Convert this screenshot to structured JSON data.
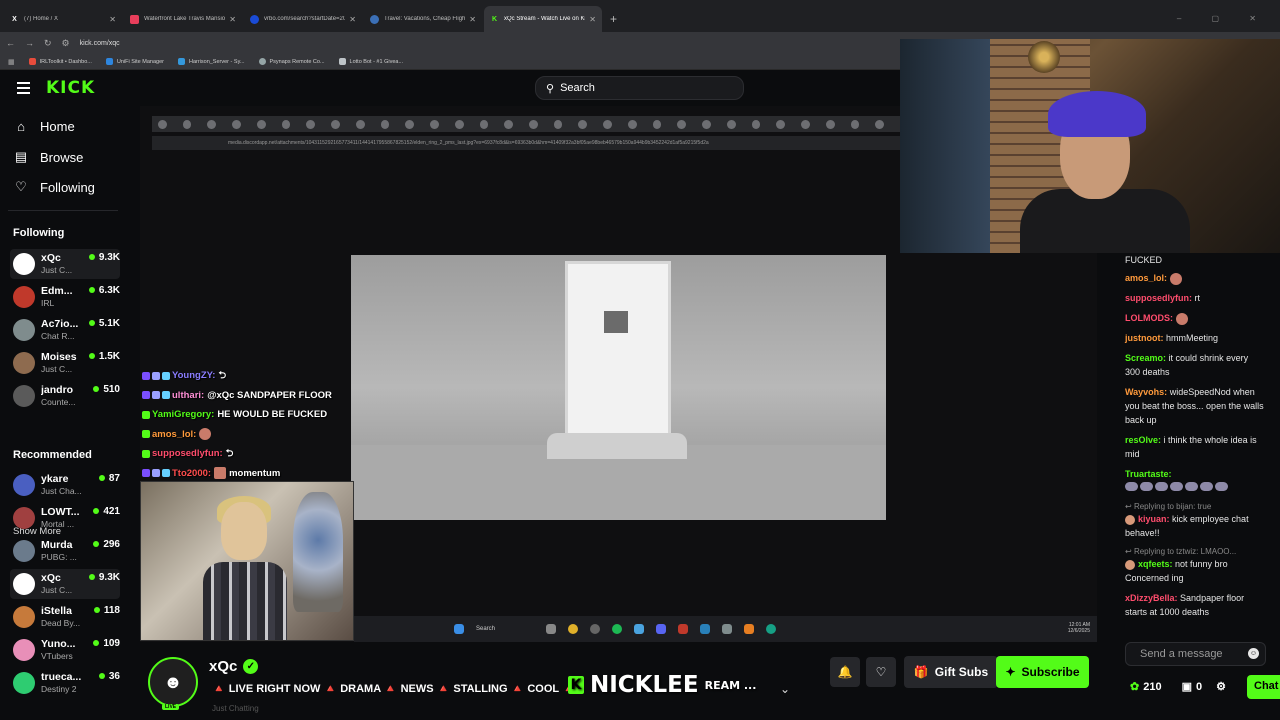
{
  "browser": {
    "tabs": [
      {
        "title": "(7) Home / X",
        "color": "#000000",
        "glyph": "X"
      },
      {
        "title": "Waterfront Lake Travis Mansion",
        "color": "#e83e5b",
        "glyph": ""
      },
      {
        "title": "vrbo.com/search?startDate=20",
        "color": "#1a4bd6",
        "glyph": ""
      },
      {
        "title": "Travel: Vacations, Cheap Flights",
        "color": "#3b6fb6",
        "glyph": ""
      },
      {
        "title": "xQc Stream - Watch Live on Kick",
        "color": "#53fc18",
        "glyph": "K"
      }
    ],
    "url": "kick.com/xqc",
    "bookmarks": [
      "IRLToolkit • Dashbo...",
      "UniFi Site Manager",
      "Harrison_Server - Sy...",
      "Psynaps Remote Co...",
      "Lotto Bot - #1 Givea..."
    ]
  },
  "header": {
    "logo": "KICK",
    "search_placeholder": "Search"
  },
  "nav": {
    "home": "Home",
    "browse": "Browse",
    "following": "Following"
  },
  "sidebar": {
    "following_heading": "Following",
    "following": [
      {
        "name": "xQc",
        "category": "Just C...",
        "viewers": "9.3K",
        "avatar": "#ffffff"
      },
      {
        "name": "Edm...",
        "category": "IRL",
        "viewers": "6.3K",
        "avatar": "#c0392b"
      },
      {
        "name": "Ac7io...",
        "category": "Chat R...",
        "viewers": "5.1K",
        "avatar": "#7f8c8d"
      },
      {
        "name": "Moises",
        "category": "Just C...",
        "viewers": "1.5K",
        "avatar": "#8e6b4f"
      },
      {
        "name": "jandro",
        "category": "Counte...",
        "viewers": "510",
        "avatar": "#5a5a5a"
      }
    ],
    "show_more": "Show More",
    "recommended_heading": "Recommended",
    "recommended": [
      {
        "name": "ykare",
        "category": "Just Cha...",
        "viewers": "87",
        "avatar": "#4a5fc1"
      },
      {
        "name": "LOWT...",
        "category": "Mortal ...",
        "viewers": "421",
        "avatar": "#a04040"
      },
      {
        "name": "Murda",
        "category": "PUBG: ...",
        "viewers": "296",
        "avatar": "#6b7b8c"
      },
      {
        "name": "xQc",
        "category": "Just C...",
        "viewers": "9.3K",
        "avatar": "#ffffff"
      },
      {
        "name": "iStella",
        "category": "Dead By...",
        "viewers": "118",
        "avatar": "#c67a3b"
      },
      {
        "name": "Yuno...",
        "category": "VTubers",
        "viewers": "109",
        "avatar": "#e88fb8"
      },
      {
        "name": "trueca...",
        "category": "Destiny 2",
        "viewers": "36",
        "avatar": "#2ecc71"
      }
    ]
  },
  "video": {
    "inner_url": "media.discordapp.net/attachments/1043115292165773411/1441417955867825152/elden_ring_2_pms_last.jpg?ex=6937fc8d&is=69363b0d&hm=41409f32a3bf05ae98beb46579b150a944b9b3452242d1af5a9215f5d2a",
    "taskbar_search": "Search",
    "clock_time": "12:01 AM",
    "clock_date": "12/6/2025"
  },
  "overlay_chat": [
    {
      "user": "YoungZY:",
      "text": "⮌",
      "color": "#8a7dff",
      "badges": [
        "#7b4fff",
        "#9aa0ff",
        "#66d0ff"
      ]
    },
    {
      "user": "ulthari:",
      "text": "@xQc SANDPAPER FLOOR",
      "color": "#ff8fd6",
      "badges": [
        "#7b4fff",
        "#9aa0ff",
        "#66d0ff"
      ]
    },
    {
      "user": "YamiGregory:",
      "text": "HE WOULD BE FUCKED",
      "color": "#53fc18",
      "badges": [
        "#53fc18"
      ]
    },
    {
      "user": "amos_lol:",
      "text": "",
      "color": "#ff9a3c",
      "badges": [
        "#53fc18"
      ]
    },
    {
      "user": "supposedlyfun:",
      "text": "⮌",
      "color": "#ff4d6d",
      "badges": [
        "#53fc18"
      ]
    },
    {
      "user": "Tto2000:",
      "text": "momentum",
      "color": "#ff4d4d",
      "badges": [
        "#7b4fff",
        "#9aa0ff",
        "#66d0ff"
      ]
    }
  ],
  "chat": {
    "messages": [
      {
        "type": "text",
        "user": "",
        "text": "FUCKED",
        "color": "#e6e6e6"
      },
      {
        "type": "emote",
        "user": "amos_lol:",
        "text": "",
        "color": "#ff9a3c"
      },
      {
        "type": "text",
        "user": "supposedlyfun:",
        "text": "rt",
        "color": "#ff4d6d"
      },
      {
        "type": "emote",
        "user": "LOLMODS:",
        "text": "",
        "color": "#ff4d6d"
      },
      {
        "type": "text",
        "user": "justnoot:",
        "text": "hmmMeeting",
        "color": "#ff9a3c"
      },
      {
        "type": "text",
        "user": "Screamo:",
        "text": "it could shrink every 300 deaths",
        "color": "#53fc18"
      },
      {
        "type": "text",
        "user": "Wayvohs:",
        "text": "wideSpeedNod when you beat the boss... open the walls back up",
        "color": "#ff9a3c"
      },
      {
        "type": "text",
        "user": "resOlve:",
        "text": "i think the whole idea is mid",
        "color": "#53fc18"
      },
      {
        "type": "emoterow",
        "user": "Truartaste:",
        "text": "",
        "color": "#53fc18"
      },
      {
        "type": "reply",
        "reply": "Replying to bijan: true",
        "user": "kiyuan:",
        "text": "kick employee chat behave!!",
        "color": "#ff4d6d"
      },
      {
        "type": "reply",
        "reply": "Replying to tztwiz: LMAOO...",
        "user": "xqfeets:",
        "text": "not funny bro Concerned ing",
        "color": "#53fc18"
      },
      {
        "type": "text",
        "user": "xDizzyBella:",
        "text": "Sandpaper floor starts at 1000 deaths",
        "color": "#ff4d6d"
      }
    ],
    "input_placeholder": "Send a message",
    "points": "210",
    "gift_count": "0",
    "chat_button": "Chat"
  },
  "stream": {
    "streamer": "xQc",
    "live_badge": "LIVE",
    "title": "🔺 LIVE RIGHT NOW 🔺 DRAMA 🔺 NEWS 🔺 STALLING 🔺 COOL 🔺 CLIC",
    "title_tail": "REAM ...",
    "sub_text": "Just Chatting",
    "banner_letter": "K",
    "banner_text": "NICKLEE",
    "gift_subs": "Gift Subs",
    "subscribe": "Subscribe"
  },
  "colors": {
    "accent": "#53fc18",
    "background": "#0b0c0e"
  }
}
